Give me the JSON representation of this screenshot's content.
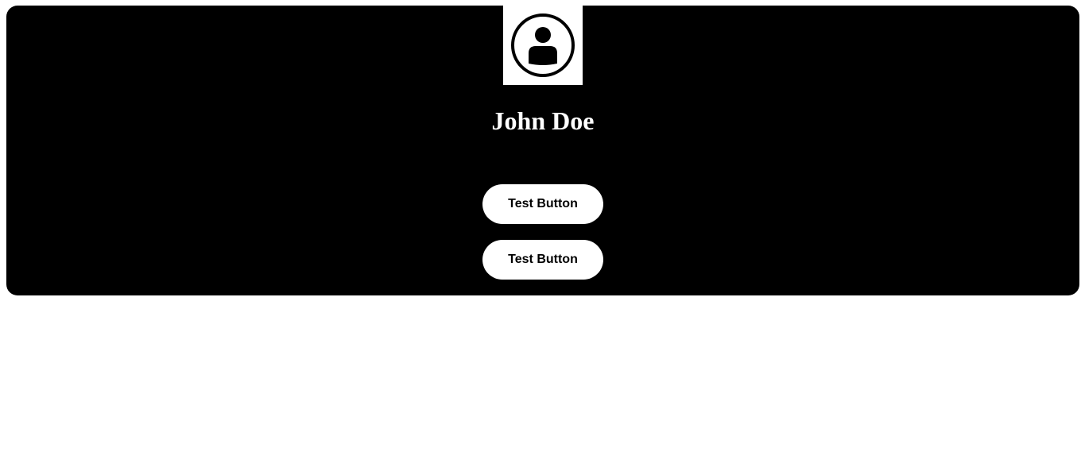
{
  "profile": {
    "avatar_icon": "user-circle-icon",
    "name": "John Doe"
  },
  "actions": {
    "buttons": [
      {
        "label": "Test Button"
      },
      {
        "label": "Test Button"
      }
    ]
  },
  "colors": {
    "card_background": "#000000",
    "page_background": "#ffffff",
    "button_background": "#ffffff",
    "button_text": "#000000",
    "name_text": "#ffffff"
  }
}
